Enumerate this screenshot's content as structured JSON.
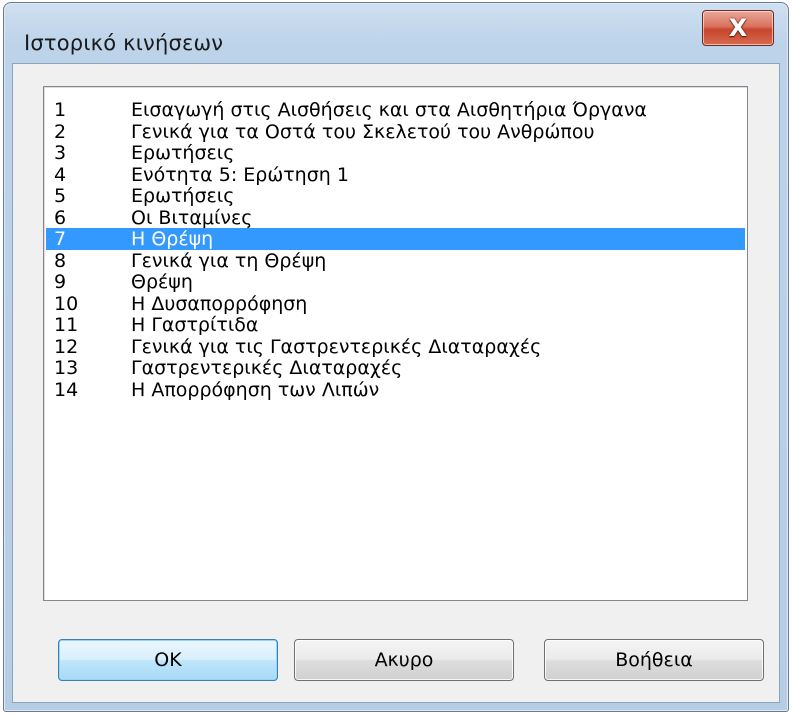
{
  "window": {
    "title": "Ιστορικό κινήσεων",
    "close_label": "X"
  },
  "history_list": {
    "selected_index": 6,
    "items": [
      {
        "num": "1",
        "text": "Εισαγωγή στις Αισθήσεις και στα Αισθητήρια Όργανα"
      },
      {
        "num": "2",
        "text": "Γενικά για τα Οστά του Σκελετού του Ανθρώπου"
      },
      {
        "num": "3",
        "text": "Ερωτήσεις"
      },
      {
        "num": "4",
        "text": "Ενότητα 5: Ερώτηση 1"
      },
      {
        "num": "5",
        "text": "Ερωτήσεις"
      },
      {
        "num": "6",
        "text": "Οι Βιταμίνες"
      },
      {
        "num": "7",
        "text": "Η Θρέψη"
      },
      {
        "num": "8",
        "text": "Γενικά για τη Θρέψη"
      },
      {
        "num": "9",
        "text": "Θρέψη"
      },
      {
        "num": "10",
        "text": "Η Δυσαπορρόφηση"
      },
      {
        "num": "11",
        "text": "Η Γαστρίτιδα"
      },
      {
        "num": "12",
        "text": "Γενικά για τις Γαστρεντερικές Διαταραχές"
      },
      {
        "num": "13",
        "text": "Γαστρεντερικές Διαταραχές"
      },
      {
        "num": "14",
        "text": "Η Απορρόφηση των Λιπών"
      }
    ]
  },
  "buttons": {
    "ok": "OK",
    "cancel": "Ακυρο",
    "help": "Βοήθεια"
  },
  "colors": {
    "selection": "#3399ff",
    "close_button": "#c7452d"
  }
}
